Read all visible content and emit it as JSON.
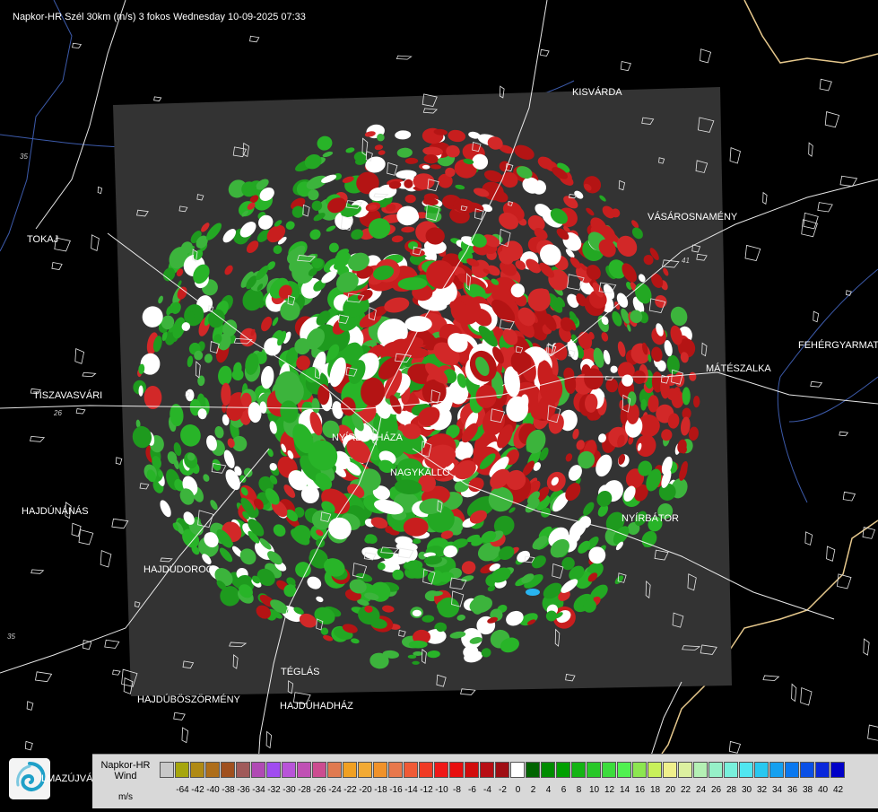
{
  "header": {
    "title": "Napkor-HR Szél 30km (m/s) 3 fokos Wednesday 10-09-2025 07:33"
  },
  "cities": [
    {
      "id": "kisvarda",
      "name": "KISVÁRDA"
    },
    {
      "id": "vasarosnameny",
      "name": "VÁSÁROSNAMÉNY"
    },
    {
      "id": "tokaj",
      "name": "TOKAJ"
    },
    {
      "id": "fehergyarmat",
      "name": "FEHÉRGYARMAT"
    },
    {
      "id": "mateszalka",
      "name": "MÁTÉSZALKA"
    },
    {
      "id": "tiszavasvari",
      "name": "TISZAVASVÁRI"
    },
    {
      "id": "nyiregyhaza",
      "name": "NYÍREGYHÁZA"
    },
    {
      "id": "nagykallo",
      "name": "NAGYKÁLLÓ"
    },
    {
      "id": "hajdunanas",
      "name": "HAJDÚNÁNÁS"
    },
    {
      "id": "nyirbator",
      "name": "NYÍRBÁTOR"
    },
    {
      "id": "hajdudorog",
      "name": "HAJDÚDOROG"
    },
    {
      "id": "teglas",
      "name": "TÉGLÁS"
    },
    {
      "id": "hajduboszormeny",
      "name": "HAJDÚBÖSZÖRMÉNY"
    },
    {
      "id": "hajduhadhaz",
      "name": "HAJDÚHADHÁZ"
    }
  ],
  "partial_label": "LMAZÚJVÁR",
  "road_numbers": [
    "35",
    "26",
    "41",
    "35"
  ],
  "legend": {
    "title_line1": "Napkor-HR",
    "title_line2": "Wind",
    "units": "m/s",
    "bins": [
      {
        "color": "#c8c8c8"
      },
      {
        "color": "#a6a60c",
        "label": "-64"
      },
      {
        "color": "#b08a14",
        "label": "-42"
      },
      {
        "color": "#ae6e1a",
        "label": "-40"
      },
      {
        "color": "#a0501e",
        "label": "-38"
      },
      {
        "color": "#a05a5a",
        "label": "-36"
      },
      {
        "color": "#b04ab4",
        "label": "-34"
      },
      {
        "color": "#a04cf0",
        "label": "-32"
      },
      {
        "color": "#b854d8",
        "label": "-30"
      },
      {
        "color": "#c050b4",
        "label": "-28"
      },
      {
        "color": "#cc4c90",
        "label": "-26"
      },
      {
        "color": "#e07a50",
        "label": "-24"
      },
      {
        "color": "#f0a022",
        "label": "-22"
      },
      {
        "color": "#f2aa34",
        "label": "-20"
      },
      {
        "color": "#f0922a",
        "label": "-18"
      },
      {
        "color": "#e8784c",
        "label": "-16"
      },
      {
        "color": "#f05a36",
        "label": "-14"
      },
      {
        "color": "#f03a24",
        "label": "-12"
      },
      {
        "color": "#f01818",
        "label": "-10"
      },
      {
        "color": "#e80e0e",
        "label": "-8"
      },
      {
        "color": "#d20c0c",
        "label": "-6"
      },
      {
        "color": "#b80e14",
        "label": "-4"
      },
      {
        "color": "#a00e14",
        "label": "-2"
      },
      {
        "color": "#ffffff",
        "label": "0"
      },
      {
        "color": "#006400",
        "label": "2"
      },
      {
        "color": "#008c00",
        "label": "4"
      },
      {
        "color": "#00a000",
        "label": "6"
      },
      {
        "color": "#14b414",
        "label": "8"
      },
      {
        "color": "#28c828",
        "label": "10"
      },
      {
        "color": "#3cdc3c",
        "label": "12"
      },
      {
        "color": "#50f050",
        "label": "14"
      },
      {
        "color": "#8ce650",
        "label": "16"
      },
      {
        "color": "#c8f05a",
        "label": "18"
      },
      {
        "color": "#f0f08c",
        "label": "20"
      },
      {
        "color": "#dcf0a0",
        "label": "22"
      },
      {
        "color": "#b4f0b4",
        "label": "24"
      },
      {
        "color": "#96f0c8",
        "label": "26"
      },
      {
        "color": "#78f0dc",
        "label": "28"
      },
      {
        "color": "#50e6f0",
        "label": "30"
      },
      {
        "color": "#28c8f0",
        "label": "32"
      },
      {
        "color": "#14a0f0",
        "label": "34"
      },
      {
        "color": "#0a78f0",
        "label": "36"
      },
      {
        "color": "#0a50e6",
        "label": "38"
      },
      {
        "color": "#0a28dc",
        "label": "40"
      },
      {
        "color": "#0000c8",
        "label": "42"
      }
    ]
  },
  "colors": {
    "background": "#000000",
    "radar_panel": "#333333",
    "border_line": "#e6c88c",
    "river": "#3c5aaa",
    "road": "#ffffff",
    "approaching": "#c81e1e",
    "receding": "#22a022",
    "zero": "#ffffff"
  }
}
